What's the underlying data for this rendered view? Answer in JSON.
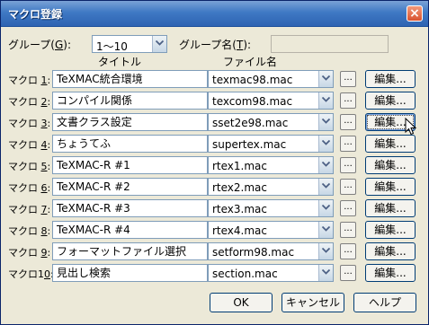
{
  "window": {
    "title": "マクロ登録",
    "close_label": "×"
  },
  "group": {
    "label_pre": "グループ(",
    "label_key": "G",
    "label_post": "):",
    "value": "1〜10",
    "name_label_pre": "グループ名(",
    "name_label_key": "T",
    "name_label_post": "):",
    "name_value": ""
  },
  "headers": {
    "title": "タイトル",
    "file": "ファイル名"
  },
  "rows": [
    {
      "label_pre": "マクロ ",
      "label_key": "1",
      "label_post": ":",
      "title": "TeXMAC統合環境",
      "file": "texmac98.mac",
      "browse": "...",
      "edit": "編集..."
    },
    {
      "label_pre": "マクロ ",
      "label_key": "2",
      "label_post": ":",
      "title": "コンパイル関係",
      "file": "texcom98.mac",
      "browse": "...",
      "edit": "編集..."
    },
    {
      "label_pre": "マクロ ",
      "label_key": "3",
      "label_post": ":",
      "title": "文書クラス設定",
      "file": "sset2e98.mac",
      "browse": "...",
      "edit": "編集..."
    },
    {
      "label_pre": "マクロ ",
      "label_key": "4",
      "label_post": ":",
      "title": "ちょうてふ",
      "file": "supertex.mac",
      "browse": "...",
      "edit": "編集..."
    },
    {
      "label_pre": "マクロ ",
      "label_key": "5",
      "label_post": ":",
      "title": "TeXMAC-R #1",
      "file": "rtex1.mac",
      "browse": "...",
      "edit": "編集..."
    },
    {
      "label_pre": "マクロ ",
      "label_key": "6",
      "label_post": ":",
      "title": "TeXMAC-R #2",
      "file": "rtex2.mac",
      "browse": "...",
      "edit": "編集..."
    },
    {
      "label_pre": "マクロ ",
      "label_key": "7",
      "label_post": ":",
      "title": "TeXMAC-R #3",
      "file": "rtex3.mac",
      "browse": "...",
      "edit": "編集..."
    },
    {
      "label_pre": "マクロ ",
      "label_key": "8",
      "label_post": ":",
      "title": "TeXMAC-R #4",
      "file": "rtex4.mac",
      "browse": "...",
      "edit": "編集..."
    },
    {
      "label_pre": "マクロ ",
      "label_key": "9",
      "label_post": ":",
      "title": "フォーマットファイル選択",
      "file": "setform98.mac",
      "browse": "...",
      "edit": "編集..."
    },
    {
      "label_pre": "マクロ1",
      "label_key": "0",
      "label_post": ":",
      "title": "見出し検索",
      "file": "section.mac",
      "browse": "...",
      "edit": "編集..."
    }
  ],
  "buttons": {
    "ok": "OK",
    "cancel": "キャンセル",
    "help": "ヘルプ"
  }
}
